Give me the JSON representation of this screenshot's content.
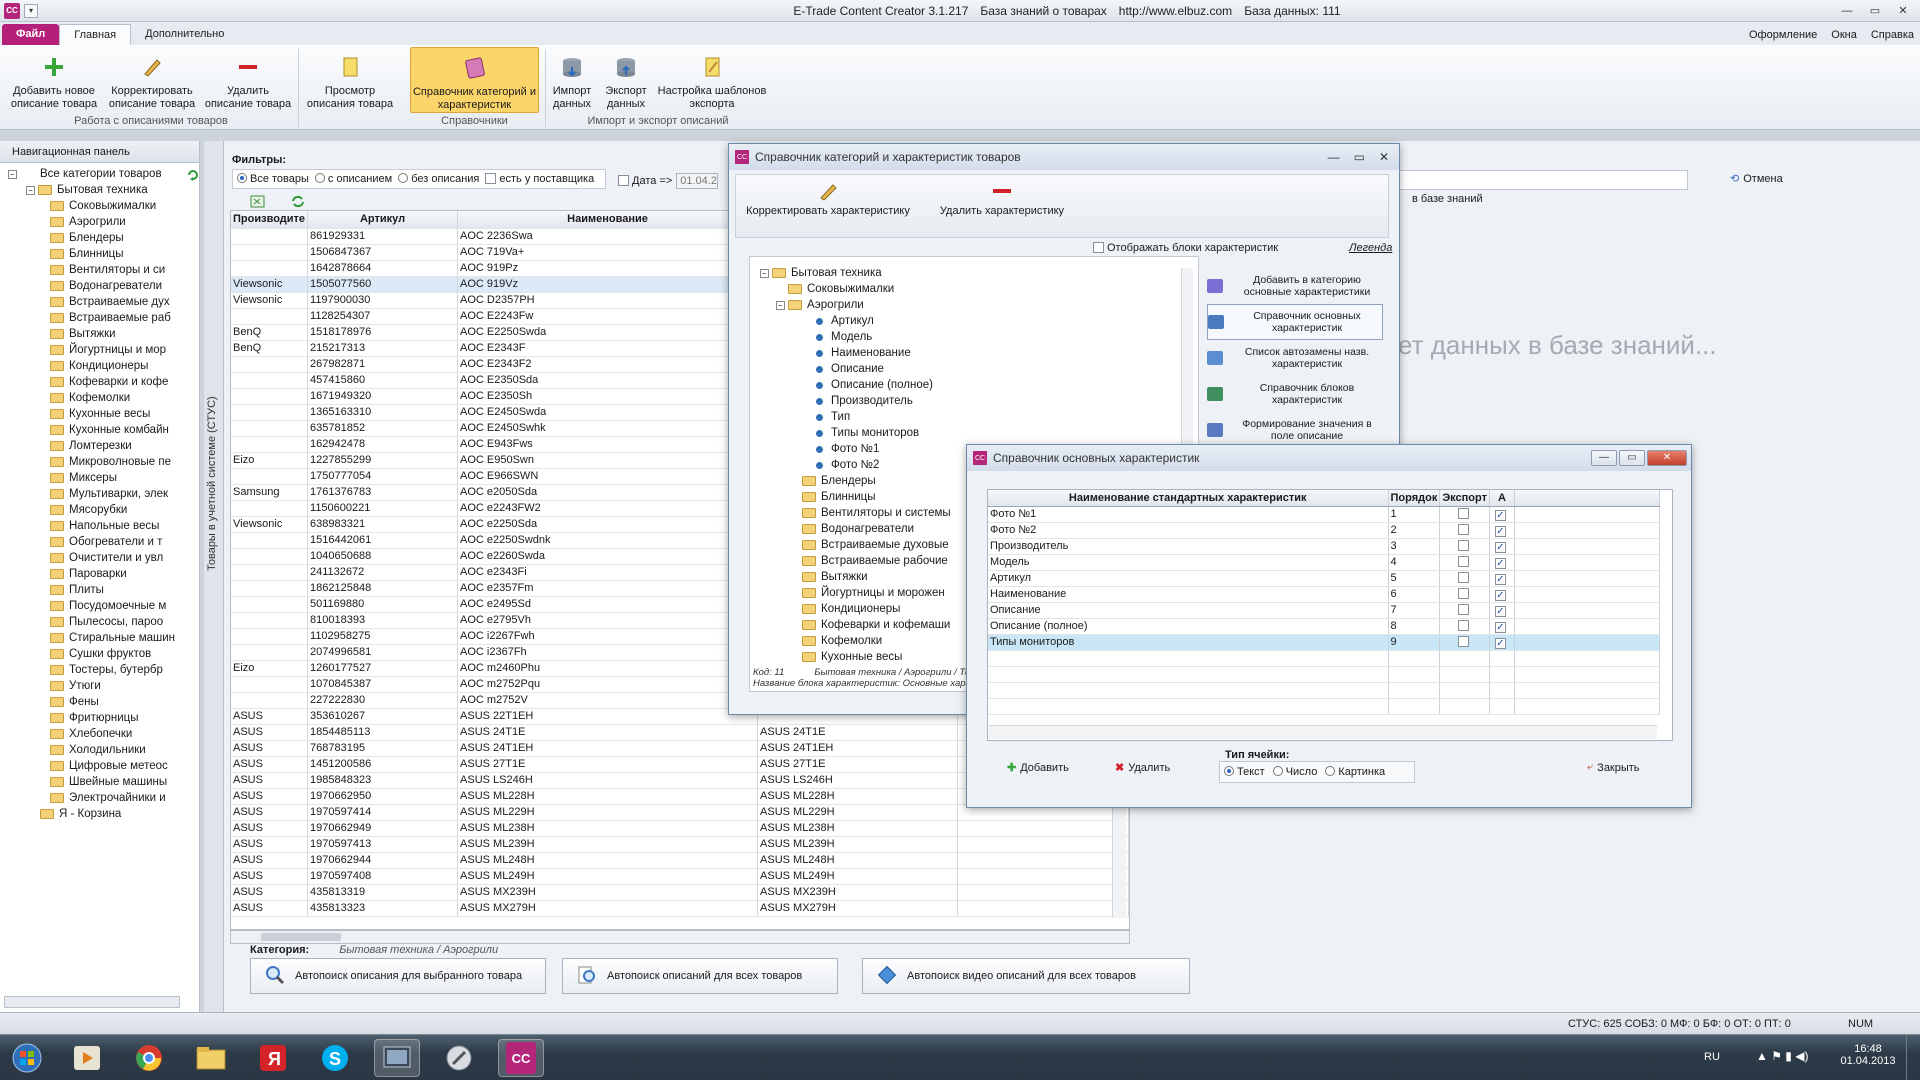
{
  "app": {
    "title": "E-Trade Content Creator 3.1.217",
    "kb_title": "База знаний о товарах",
    "url": "http://www.elbuz.com",
    "db": "База данных: 111"
  },
  "tabs": {
    "file": "Файл",
    "home": "Главная",
    "extra": "Дополнительно"
  },
  "topright": {
    "design": "Оформление",
    "windows": "Окна",
    "help": "Справка"
  },
  "ribbon": {
    "add": "Добавить новое описание товара",
    "edit": "Корректировать описание товара",
    "del": "Удалить описание товара",
    "view": "Просмотр описания товара",
    "ref": "Справочник категорий и характеристик",
    "import": "Импорт данных",
    "export": "Экспорт данных",
    "tpl": "Настройка шаблонов экспорта",
    "group1": "Работа с описаниями товаров",
    "group2": "Справочники",
    "group3": "Импорт и экспорт описаний"
  },
  "nav": {
    "title": "Навигационная панель",
    "root": "Все категории товаров",
    "cat": "Бытовая техника",
    "items": [
      "Соковыжималки",
      "Аэрогрили",
      "Блендеры",
      "Блинницы",
      "Вентиляторы и си",
      "Водонагреватели",
      "Встраиваемые дух",
      "Встраиваемые раб",
      "Вытяжки",
      "Йогуртницы и мор",
      "Кондиционеры",
      "Кофеварки и кофе",
      "Кофемолки",
      "Кухонные весы",
      "Кухонные комбайн",
      "Ломтерезки",
      "Микроволновые пе",
      "Миксеры",
      "Мультиварки, элек",
      "Мясорубки",
      "Напольные весы",
      "Обогреватели и т",
      "Очистители и увл",
      "Пароварки",
      "Плиты",
      "Посудомоечные м",
      "Пылесосы, пароо",
      "Стиральные машин",
      "Сушки фруктов",
      "Тостеры, бутербр",
      "Утюги",
      "Фены",
      "Фритюрницы",
      "Хлебопечки",
      "Холодильники",
      "Цифровые метеос",
      "Швейные машины",
      "Электрочайники и"
    ],
    "basket": "Я - Корзина",
    "vertical": "Товары в учетной системе (СТУС)"
  },
  "filters": {
    "label": "Фильтры:",
    "all": "Все товары",
    "with": "с описанием",
    "without": "без описания",
    "supplier": "есть у поставщика",
    "date": "Дата =>",
    "date_val": "01.04.2"
  },
  "grid": {
    "headers": [
      "Производите",
      "Артикул",
      "Наименование"
    ],
    "rows": [
      [
        "",
        "861929331",
        "AOC 2236Swa",
        ""
      ],
      [
        "",
        "1506847367",
        "AOC 719Va+",
        ""
      ],
      [
        "",
        "1642878664",
        "AOC 919Pz",
        ""
      ],
      [
        "Viewsonic",
        "1505077560",
        "AOC 919Vz",
        ""
      ],
      [
        "Viewsonic",
        "1197900030",
        "AOC D2357PH",
        ""
      ],
      [
        "",
        "1128254307",
        "AOC E2243Fw",
        ""
      ],
      [
        "BenQ",
        "1518178976",
        "AOC E2250Swda",
        ""
      ],
      [
        "BenQ",
        "215217313",
        "AOC E2343F",
        ""
      ],
      [
        "",
        "267982871",
        "AOC E2343F2",
        ""
      ],
      [
        "",
        "457415860",
        "AOC E2350Sda",
        ""
      ],
      [
        "",
        "1671949320",
        "AOC E2350Sh",
        ""
      ],
      [
        "",
        "1365163310",
        "AOC E2450Swda",
        ""
      ],
      [
        "",
        "635781852",
        "AOC E2450Swhk",
        ""
      ],
      [
        "",
        "162942478",
        "AOC E943Fws",
        ""
      ],
      [
        "Eizo",
        "1227855299",
        "AOC E950Swn",
        ""
      ],
      [
        "",
        "1750777054",
        "AOC E966SWN",
        ""
      ],
      [
        "Samsung",
        "1761376783",
        "AOC e2050Sda",
        ""
      ],
      [
        "",
        "1150600221",
        "AOC e2243FW2",
        ""
      ],
      [
        "Viewsonic",
        "638983321",
        "AOC e2250Sda",
        ""
      ],
      [
        "",
        "1516442061",
        "AOC e2250Swdnk",
        ""
      ],
      [
        "",
        "1040650688",
        "AOC e2260Swda",
        ""
      ],
      [
        "",
        "241132672",
        "AOC e2343Fi",
        ""
      ],
      [
        "",
        "1862125848",
        "AOC e2357Fm",
        ""
      ],
      [
        "",
        "501169880",
        "AOC e2495Sd",
        ""
      ],
      [
        "",
        "810018393",
        "AOC e2795Vh",
        ""
      ],
      [
        "",
        "1102958275",
        "AOC i2267Fwh",
        ""
      ],
      [
        "",
        "2074996581",
        "AOC i2367Fh",
        ""
      ],
      [
        "Eizo",
        "1260177527",
        "AOC m2460Phu",
        ""
      ],
      [
        "",
        "1070845387",
        "AOC m2752Pqu",
        ""
      ],
      [
        "",
        "227222830",
        "AOC m2752V",
        ""
      ],
      [
        "ASUS",
        "353610267",
        "ASUS 22T1EH",
        ""
      ],
      [
        "ASUS",
        "1854485113",
        "ASUS 24T1E",
        "ASUS 24T1E"
      ],
      [
        "ASUS",
        "768783195",
        "ASUS 24T1EH",
        "ASUS 24T1EH"
      ],
      [
        "ASUS",
        "1451200586",
        "ASUS 27T1E",
        "ASUS 27T1E"
      ],
      [
        "ASUS",
        "1985848323",
        "ASUS LS246H",
        "ASUS LS246H"
      ],
      [
        "ASUS",
        "1970662950",
        "ASUS ML228H",
        "ASUS ML228H"
      ],
      [
        "ASUS",
        "1970597414",
        "ASUS ML229H",
        "ASUS ML229H"
      ],
      [
        "ASUS",
        "1970662949",
        "ASUS ML238H",
        "ASUS ML238H"
      ],
      [
        "ASUS",
        "1970597413",
        "ASUS ML239H",
        "ASUS ML239H"
      ],
      [
        "ASUS",
        "1970662944",
        "ASUS ML248H",
        "ASUS ML248H"
      ],
      [
        "ASUS",
        "1970597408",
        "ASUS ML249H",
        "ASUS ML249H"
      ],
      [
        "ASUS",
        "435813319",
        "ASUS MX239H",
        "ASUS MX239H"
      ],
      [
        "ASUS",
        "435813323",
        "ASUS MX279H",
        "ASUS MX279H"
      ]
    ]
  },
  "category": {
    "label": "Категория:",
    "value": "Бытовая техника / Аэрогрили"
  },
  "bottom": {
    "b1": "Автопоиск описания для выбранного товара",
    "b2": "Автопоиск описаний для всех товаров",
    "b3": "Автопоиск видео описаний для всех товаров"
  },
  "right": {
    "cancel": "Отмена",
    "kb": "в базе знаний",
    "nodata": "ет данных в базе знаний..."
  },
  "dlg1": {
    "title": "Справочник категорий и характеристик товаров",
    "edit": "Корректировать характеристику",
    "del": "Удалить характеристику",
    "showblocks": "Отображать блоки характеристик",
    "legend": "Легенда",
    "tree_root": "Бытовая техника",
    "n1": "Соковыжималки",
    "n2": "Аэрогрили",
    "chars": [
      "Артикул",
      "Модель",
      "Наименование",
      "Описание",
      "Описание (полное)",
      "Производитель",
      "Тип",
      "Типы мониторов",
      "Фото №1",
      "Фото №2"
    ],
    "after": [
      "Блендеры",
      "Блинницы",
      "Вентиляторы и системы",
      "Водонагреватели",
      "Встраиваемые духовые",
      "Встраиваемые рабочие",
      "Вытяжки",
      "Йогуртницы и морожен",
      "Кондиционеры",
      "Кофеварки и кофемаши",
      "Кофемолки",
      "Кухонные весы"
    ],
    "side": [
      "Добавить в категорию основные характеристики",
      "Справочник основных характеристик",
      "Список автозамены назв. характеристик",
      "Справочник блоков характеристик",
      "Формирование значения в поле описание"
    ],
    "code": "Код: 11",
    "path": "Бытовая техника / Аэрогрили / Ти",
    "blockname": "Название блока характеристик: Основные харак"
  },
  "dlg2": {
    "title": "Справочник основных характеристик",
    "headers": [
      "Наименование стандартных характеристик",
      "Порядок",
      "Экспорт",
      "А"
    ],
    "rows": [
      [
        "Фото №1",
        "1"
      ],
      [
        "Фото №2",
        "2"
      ],
      [
        "Производитель",
        "3"
      ],
      [
        "Модель",
        "4"
      ],
      [
        "Артикул",
        "5"
      ],
      [
        "Наименование",
        "6"
      ],
      [
        "Описание",
        "7"
      ],
      [
        "Описание (полное)",
        "8"
      ],
      [
        "Типы мониторов",
        "9"
      ]
    ],
    "add": "Добавить",
    "del": "Удалить",
    "celltype": "Тип ячейки:",
    "t1": "Текст",
    "t2": "Число",
    "t3": "Картинка",
    "close": "Закрыть"
  },
  "status": {
    "text": "СТУС: 625  СОБЗ: 0  МФ: 0  БФ: 0  ОТ: 0  ПТ: 0",
    "num": "NUM"
  },
  "tray": {
    "lang": "RU",
    "time": "16:48",
    "date": "01.04.2013"
  }
}
